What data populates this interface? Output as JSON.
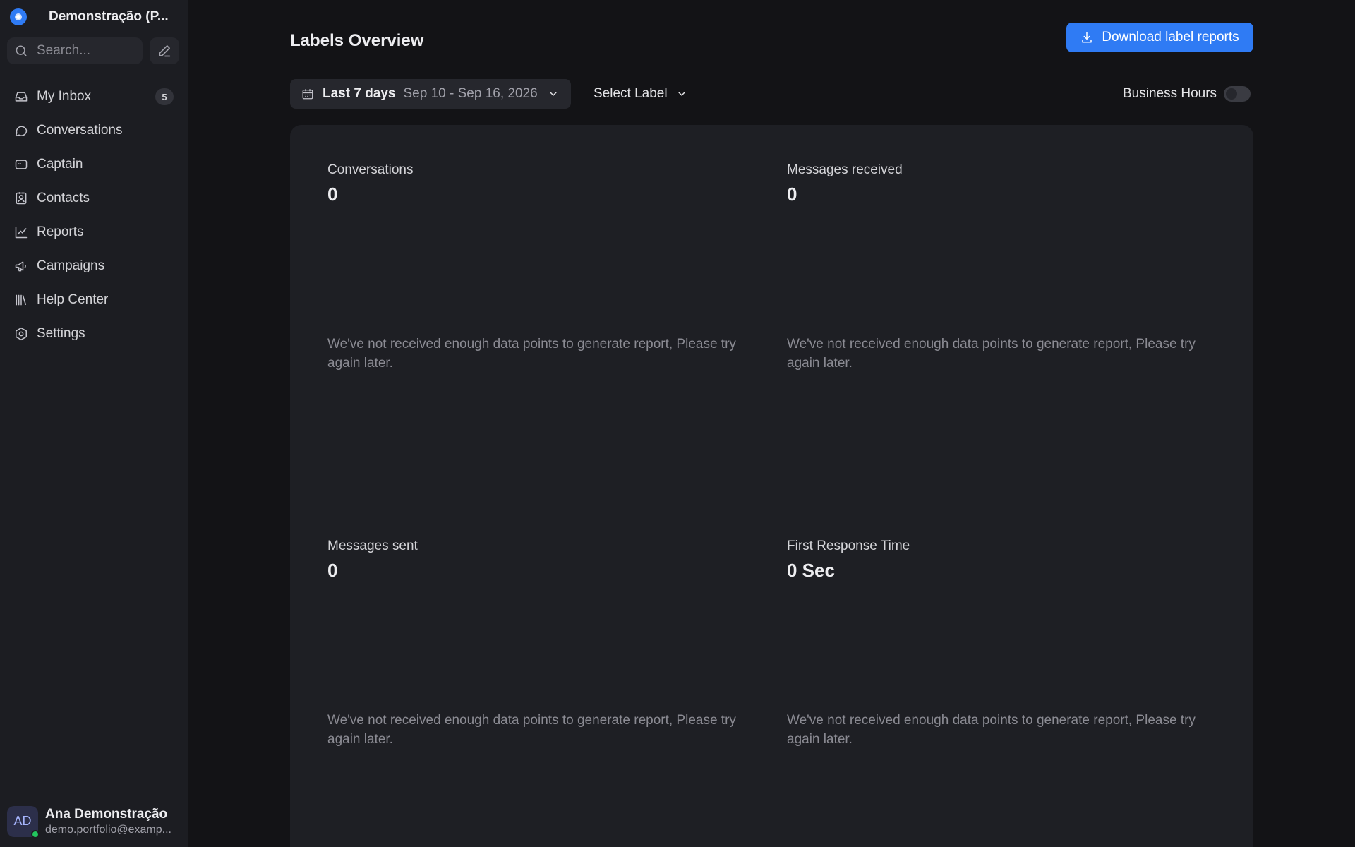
{
  "sidebar": {
    "account_name": "Demonstração (P...",
    "search": {
      "placeholder": "Search..."
    },
    "items": [
      {
        "label": "My Inbox",
        "icon": "inbox-icon",
        "badge": "5"
      },
      {
        "label": "Conversations",
        "icon": "message-circle-icon"
      },
      {
        "label": "Captain",
        "icon": "captain-bot-icon"
      },
      {
        "label": "Contacts",
        "icon": "contact-card-icon"
      },
      {
        "label": "Reports",
        "icon": "line-chart-icon"
      },
      {
        "label": "Campaigns",
        "icon": "megaphone-icon"
      },
      {
        "label": "Help Center",
        "icon": "library-icon"
      },
      {
        "label": "Settings",
        "icon": "settings-hexagon-icon"
      }
    ],
    "user": {
      "initials": "AD",
      "name": "Ana Demonstração",
      "email": "demo.portfolio@examp..."
    }
  },
  "header": {
    "title": "Labels Overview",
    "download_label": "Download label reports"
  },
  "filters": {
    "range_label": "Last 7 days",
    "range_value": "Sep 10 - Sep 16, 2026",
    "label_select": "Select Label",
    "business_hours_label": "Business Hours",
    "business_hours_on": false
  },
  "metrics": [
    {
      "title": "Conversations",
      "value": "0",
      "empty_message": "We've not received enough data points to generate report, Please try again later."
    },
    {
      "title": "Messages received",
      "value": "0",
      "empty_message": "We've not received enough data points to generate report, Please try again later."
    },
    {
      "title": "Messages sent",
      "value": "0",
      "empty_message": "We've not received enough data points to generate report, Please try again later."
    },
    {
      "title": "First Response Time",
      "value": "0 Sec",
      "empty_message": "We've not received enough data points to generate report, Please try again later."
    }
  ],
  "colors": {
    "accent": "#2f7bf4",
    "sidebar_bg": "#1c1d22",
    "page_bg": "#131316",
    "panel_bg": "#1e1f24",
    "online": "#22c55e"
  }
}
